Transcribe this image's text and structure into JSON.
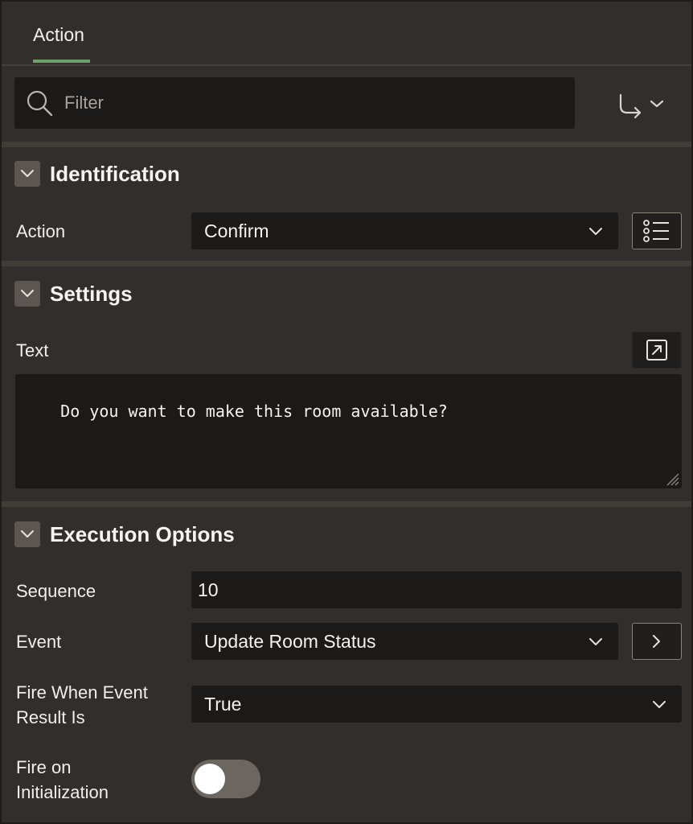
{
  "tabs": [
    {
      "label": "Action",
      "active": true
    }
  ],
  "filter": {
    "placeholder": "Filter"
  },
  "sections": {
    "identification": {
      "title": "Identification",
      "action_label": "Action",
      "action_value": "Confirm"
    },
    "settings": {
      "title": "Settings",
      "text_label": "Text",
      "text_value": "Do you want to make this room available?"
    },
    "execution": {
      "title": "Execution Options",
      "sequence_label": "Sequence",
      "sequence_value": "10",
      "event_label": "Event",
      "event_value": "Update Room Status",
      "fire_when_label": "Fire When Event Result Is",
      "fire_when_value": "True",
      "fire_on_init_label": "Fire on Initialization",
      "fire_on_init_value": false
    }
  },
  "icons": {
    "search": "search-icon",
    "goto": "goto-arrow-icon",
    "collapse": "chevron-down-icon",
    "list": "list-icon",
    "expand": "open-dialog-icon",
    "next": "chevron-right-icon"
  },
  "colors": {
    "background": "#312e2b",
    "field": "#1b1a19",
    "accent": "#6ea26a"
  }
}
